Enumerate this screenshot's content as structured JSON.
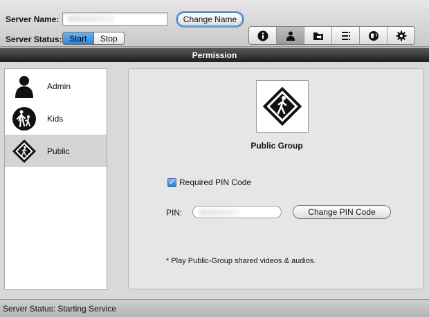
{
  "header": {
    "server_name_label": "Server Name:",
    "server_name_value": "",
    "change_name_button": "Change Name",
    "server_status_label": "Server Status:",
    "status_segments": [
      "Start",
      "Stop"
    ],
    "status_selected": "Start"
  },
  "toolbar": {
    "icons": [
      "info-icon",
      "user-permission-icon",
      "shared-folder-icon",
      "list-icon",
      "network-globe-icon",
      "settings-gear-icon"
    ],
    "selected": "user-permission-icon"
  },
  "section_title": "Permission",
  "sidebar": {
    "items": [
      {
        "label": "Admin",
        "icon": "admin-person-icon"
      },
      {
        "label": "Kids",
        "icon": "kids-pedestrian-icon"
      },
      {
        "label": "Public",
        "icon": "public-sign-icon"
      }
    ],
    "selected": "Public"
  },
  "detail": {
    "group_title": "Public Group",
    "pin_required_label": "Required PIN Code",
    "pin_required_checked": true,
    "pin_label": "PIN:",
    "pin_value": "",
    "change_pin_button": "Change PIN Code",
    "note": "* Play Public-Group shared videos & audios."
  },
  "status_bar": {
    "text": "Server Status: Starting Service"
  },
  "colors": {
    "accent": "#2e84d8",
    "title_bar": "#2a2a2a",
    "selected_row": "#d4d4d4"
  }
}
